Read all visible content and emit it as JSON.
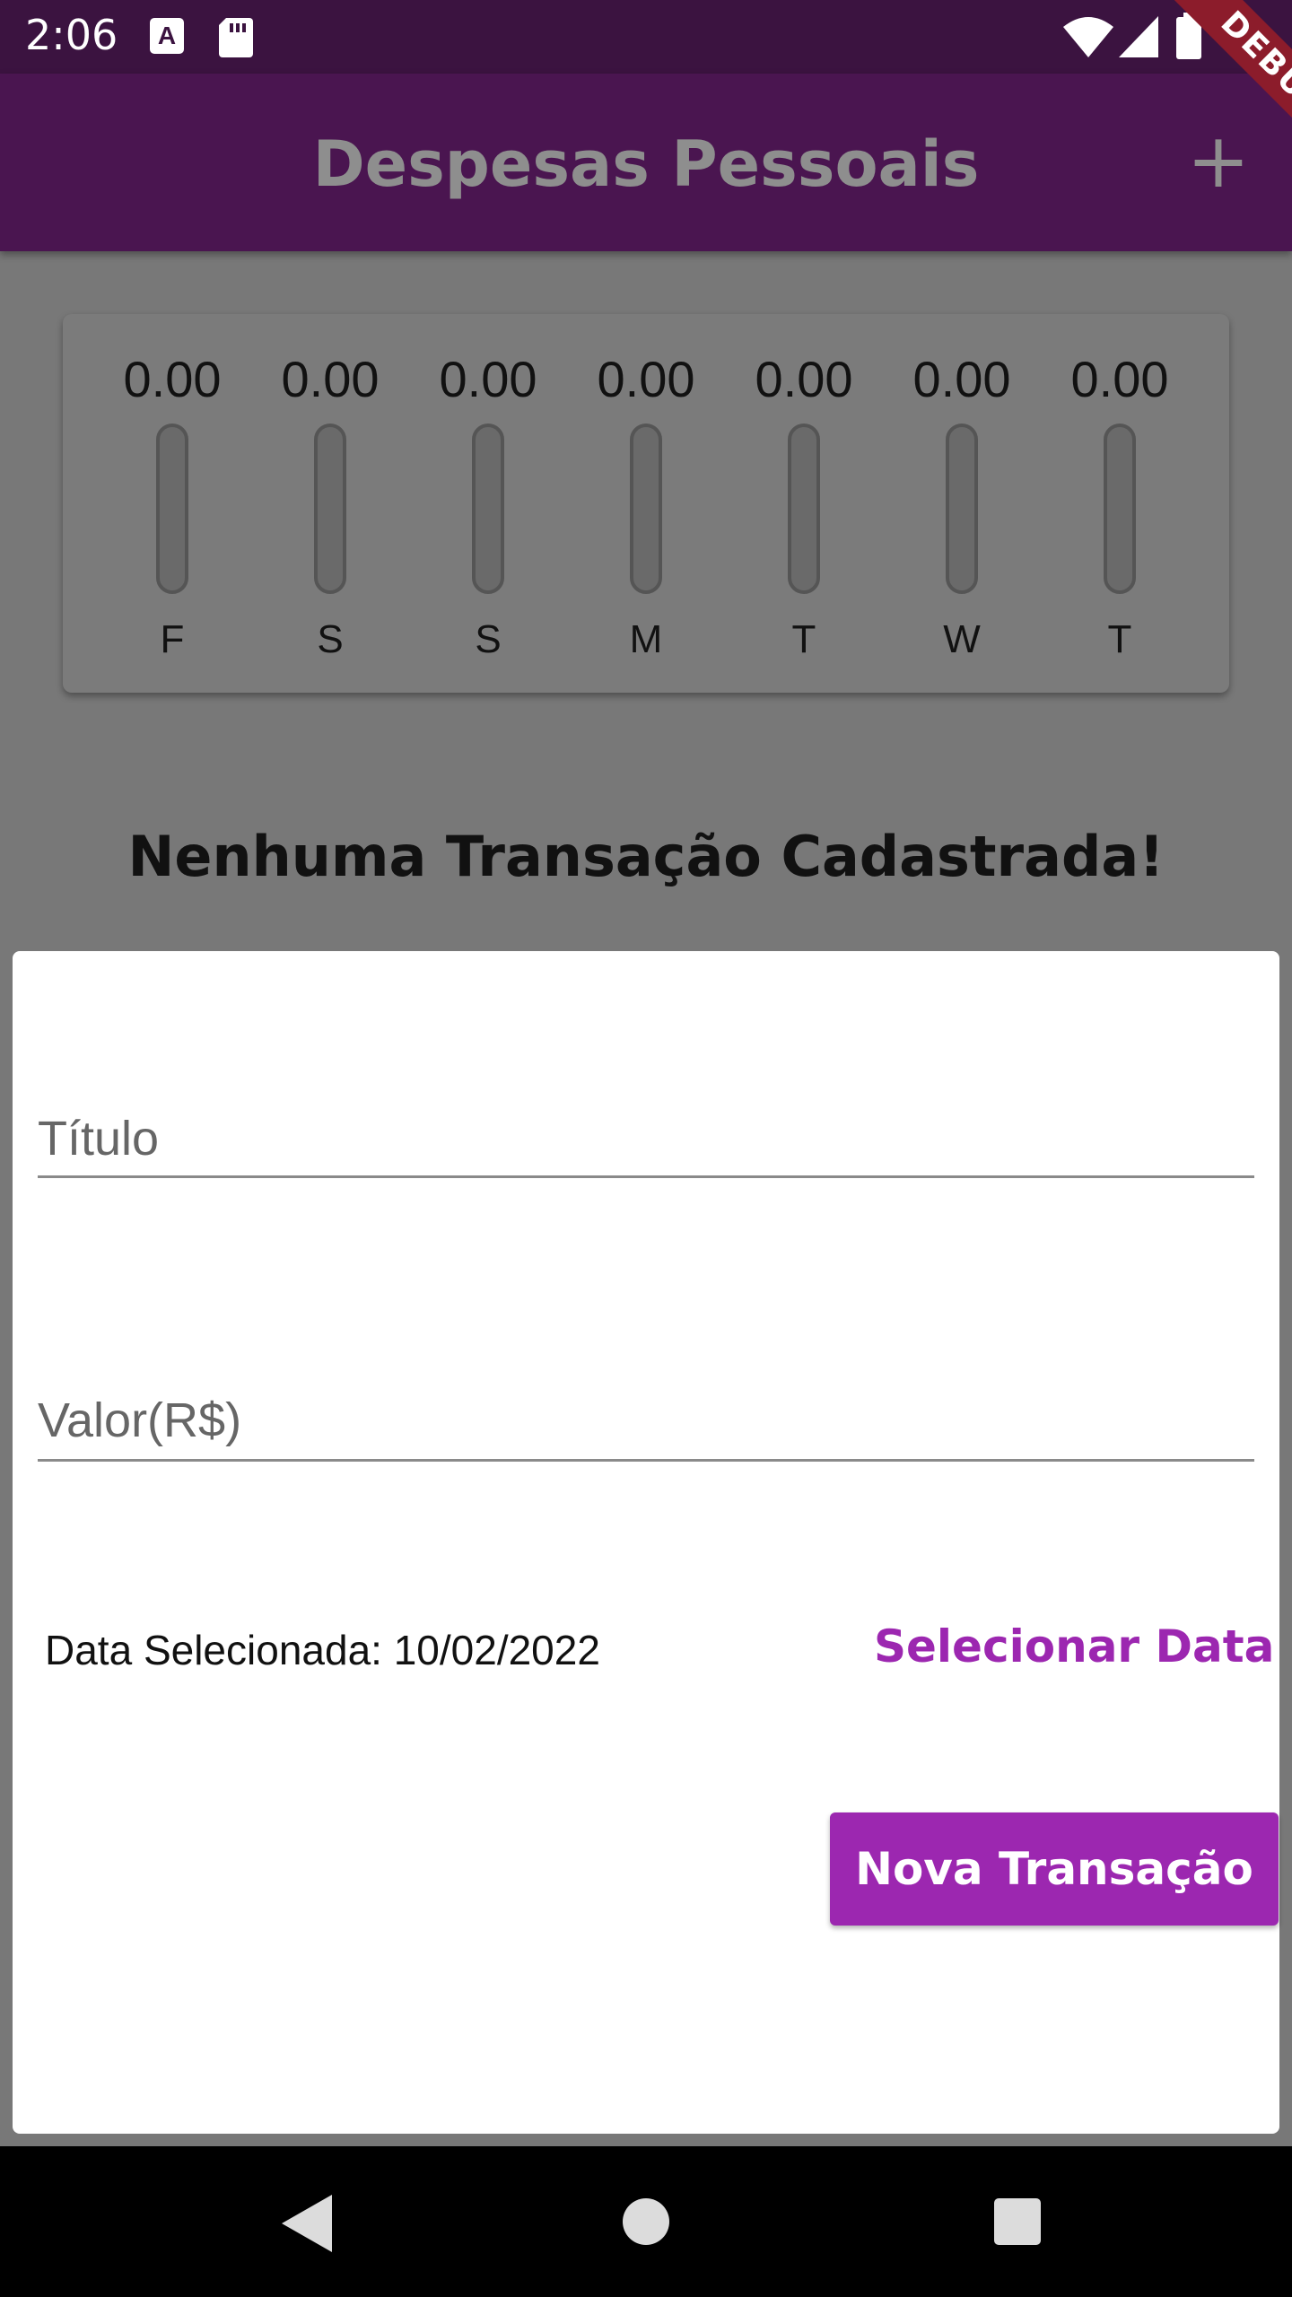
{
  "status_bar": {
    "time": "2:06",
    "icons": [
      "a-icon",
      "sd-card-icon",
      "wifi-icon",
      "signal-icon",
      "battery-icon"
    ]
  },
  "debug_banner": "DEBUG",
  "app_bar": {
    "title": "Despesas Pessoais",
    "add_label": "+",
    "background": "#4a1550"
  },
  "chart_data": {
    "type": "bar",
    "categories": [
      "F",
      "S",
      "S",
      "M",
      "T",
      "W",
      "T"
    ],
    "values": [
      0,
      0,
      0,
      0,
      0,
      0,
      0
    ],
    "value_labels": [
      "0.00",
      "0.00",
      "0.00",
      "0.00",
      "0.00",
      "0.00",
      "0.00"
    ],
    "title": "",
    "xlabel": "",
    "ylabel": "",
    "ylim": [
      0,
      1
    ],
    "fill_color": "#6a1b9a"
  },
  "empty_message": "Nenhuma Transação Cadastrada!",
  "form": {
    "title_field": {
      "label": "Título",
      "value": ""
    },
    "value_field": {
      "label": "Valor(R$)",
      "value": ""
    },
    "date_text": "Data Selecionada: 10/02/2022",
    "select_date_label": "Selecionar Data",
    "submit_label": "Nova Transação",
    "accent": "#9c27b0"
  },
  "nav_bar": {
    "icons": [
      "back-icon",
      "home-icon",
      "recents-icon"
    ]
  }
}
